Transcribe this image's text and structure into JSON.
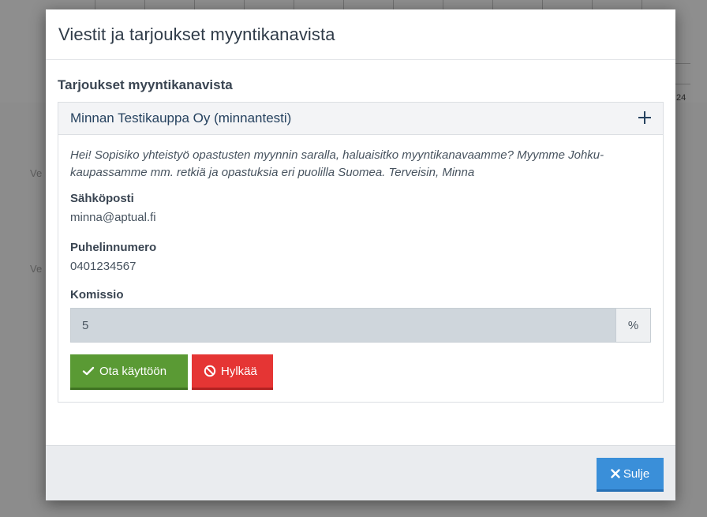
{
  "background": {
    "calendar_number": "24",
    "side_labels": [
      "Ve",
      "Ve"
    ]
  },
  "modal": {
    "title": "Viestit ja tarjoukset myyntikanavista",
    "section_title": "Tarjoukset myyntikanavista",
    "offer": {
      "seller": "Minnan Testikauppa Oy (minnantesti)",
      "expand_icon": "plus-icon",
      "message": "Hei! Sopisiko yhteistyö opastusten myynnin saralla, haluaisitko myyntikanavaamme? Myymme Johku-kaupassamme mm. retkiä ja opastuksia eri puolilla Suomea. Terveisin, Minna",
      "email_label": "Sähköposti",
      "email_value": "minna@aptual.fi",
      "phone_label": "Puhelinnumero",
      "phone_value": "0401234567",
      "commission_label": "Komissio",
      "commission_value": "5",
      "commission_unit": "%",
      "accept_label": "Ota käyttöön",
      "accept_icon": "check-icon",
      "reject_label": "Hylkää",
      "reject_icon": "ban-icon"
    },
    "footer": {
      "close_label": "Sulje",
      "close_icon": "close-icon"
    }
  },
  "colors": {
    "accept": "#5a9a34",
    "reject": "#e53534",
    "close": "#3a8fd9",
    "title": "#2f3b48"
  }
}
